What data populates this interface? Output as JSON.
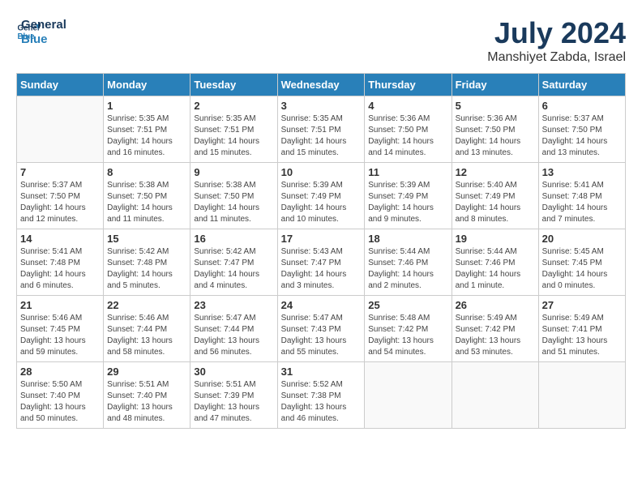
{
  "logo": {
    "line1": "General",
    "line2": "Blue"
  },
  "title": "July 2024",
  "location": "Manshiyet Zabda, Israel",
  "days_of_week": [
    "Sunday",
    "Monday",
    "Tuesday",
    "Wednesday",
    "Thursday",
    "Friday",
    "Saturday"
  ],
  "weeks": [
    [
      {
        "day": "",
        "info": ""
      },
      {
        "day": "1",
        "info": "Sunrise: 5:35 AM\nSunset: 7:51 PM\nDaylight: 14 hours\nand 16 minutes."
      },
      {
        "day": "2",
        "info": "Sunrise: 5:35 AM\nSunset: 7:51 PM\nDaylight: 14 hours\nand 15 minutes."
      },
      {
        "day": "3",
        "info": "Sunrise: 5:35 AM\nSunset: 7:51 PM\nDaylight: 14 hours\nand 15 minutes."
      },
      {
        "day": "4",
        "info": "Sunrise: 5:36 AM\nSunset: 7:50 PM\nDaylight: 14 hours\nand 14 minutes."
      },
      {
        "day": "5",
        "info": "Sunrise: 5:36 AM\nSunset: 7:50 PM\nDaylight: 14 hours\nand 13 minutes."
      },
      {
        "day": "6",
        "info": "Sunrise: 5:37 AM\nSunset: 7:50 PM\nDaylight: 14 hours\nand 13 minutes."
      }
    ],
    [
      {
        "day": "7",
        "info": "Sunrise: 5:37 AM\nSunset: 7:50 PM\nDaylight: 14 hours\nand 12 minutes."
      },
      {
        "day": "8",
        "info": "Sunrise: 5:38 AM\nSunset: 7:50 PM\nDaylight: 14 hours\nand 11 minutes."
      },
      {
        "day": "9",
        "info": "Sunrise: 5:38 AM\nSunset: 7:50 PM\nDaylight: 14 hours\nand 11 minutes."
      },
      {
        "day": "10",
        "info": "Sunrise: 5:39 AM\nSunset: 7:49 PM\nDaylight: 14 hours\nand 10 minutes."
      },
      {
        "day": "11",
        "info": "Sunrise: 5:39 AM\nSunset: 7:49 PM\nDaylight: 14 hours\nand 9 minutes."
      },
      {
        "day": "12",
        "info": "Sunrise: 5:40 AM\nSunset: 7:49 PM\nDaylight: 14 hours\nand 8 minutes."
      },
      {
        "day": "13",
        "info": "Sunrise: 5:41 AM\nSunset: 7:48 PM\nDaylight: 14 hours\nand 7 minutes."
      }
    ],
    [
      {
        "day": "14",
        "info": "Sunrise: 5:41 AM\nSunset: 7:48 PM\nDaylight: 14 hours\nand 6 minutes."
      },
      {
        "day": "15",
        "info": "Sunrise: 5:42 AM\nSunset: 7:48 PM\nDaylight: 14 hours\nand 5 minutes."
      },
      {
        "day": "16",
        "info": "Sunrise: 5:42 AM\nSunset: 7:47 PM\nDaylight: 14 hours\nand 4 minutes."
      },
      {
        "day": "17",
        "info": "Sunrise: 5:43 AM\nSunset: 7:47 PM\nDaylight: 14 hours\nand 3 minutes."
      },
      {
        "day": "18",
        "info": "Sunrise: 5:44 AM\nSunset: 7:46 PM\nDaylight: 14 hours\nand 2 minutes."
      },
      {
        "day": "19",
        "info": "Sunrise: 5:44 AM\nSunset: 7:46 PM\nDaylight: 14 hours\nand 1 minute."
      },
      {
        "day": "20",
        "info": "Sunrise: 5:45 AM\nSunset: 7:45 PM\nDaylight: 14 hours\nand 0 minutes."
      }
    ],
    [
      {
        "day": "21",
        "info": "Sunrise: 5:46 AM\nSunset: 7:45 PM\nDaylight: 13 hours\nand 59 minutes."
      },
      {
        "day": "22",
        "info": "Sunrise: 5:46 AM\nSunset: 7:44 PM\nDaylight: 13 hours\nand 58 minutes."
      },
      {
        "day": "23",
        "info": "Sunrise: 5:47 AM\nSunset: 7:44 PM\nDaylight: 13 hours\nand 56 minutes."
      },
      {
        "day": "24",
        "info": "Sunrise: 5:47 AM\nSunset: 7:43 PM\nDaylight: 13 hours\nand 55 minutes."
      },
      {
        "day": "25",
        "info": "Sunrise: 5:48 AM\nSunset: 7:42 PM\nDaylight: 13 hours\nand 54 minutes."
      },
      {
        "day": "26",
        "info": "Sunrise: 5:49 AM\nSunset: 7:42 PM\nDaylight: 13 hours\nand 53 minutes."
      },
      {
        "day": "27",
        "info": "Sunrise: 5:49 AM\nSunset: 7:41 PM\nDaylight: 13 hours\nand 51 minutes."
      }
    ],
    [
      {
        "day": "28",
        "info": "Sunrise: 5:50 AM\nSunset: 7:40 PM\nDaylight: 13 hours\nand 50 minutes."
      },
      {
        "day": "29",
        "info": "Sunrise: 5:51 AM\nSunset: 7:40 PM\nDaylight: 13 hours\nand 48 minutes."
      },
      {
        "day": "30",
        "info": "Sunrise: 5:51 AM\nSunset: 7:39 PM\nDaylight: 13 hours\nand 47 minutes."
      },
      {
        "day": "31",
        "info": "Sunrise: 5:52 AM\nSunset: 7:38 PM\nDaylight: 13 hours\nand 46 minutes."
      },
      {
        "day": "",
        "info": ""
      },
      {
        "day": "",
        "info": ""
      },
      {
        "day": "",
        "info": ""
      }
    ]
  ]
}
